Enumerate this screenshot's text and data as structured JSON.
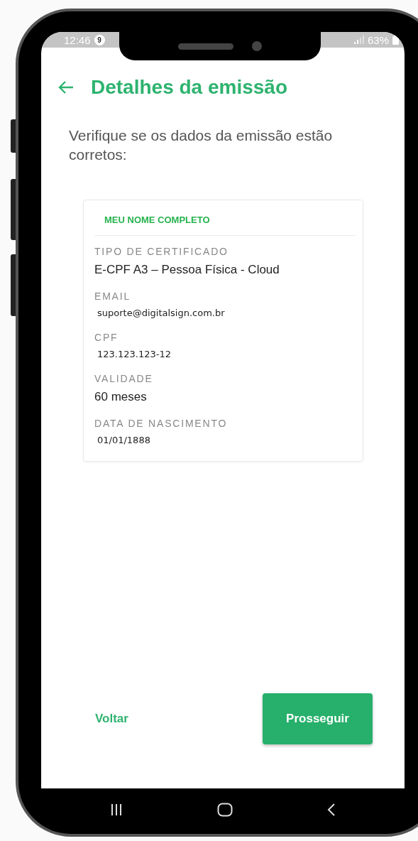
{
  "status_bar": {
    "time": "12:46",
    "notification_count": "9",
    "battery": "63%"
  },
  "header": {
    "title": "Detalhes da emissão"
  },
  "intro": "Verifique se os dados da emissão estão corretos:",
  "card": {
    "name": "MEU NOME COMPLETO",
    "fields": [
      {
        "label": "TIPO DE CERTIFICADO",
        "value": "E-CPF A3 – Pessoa Física - Cloud",
        "kind": "sans"
      },
      {
        "label": "EMAIL",
        "value": "suporte@digitalsign.com.br",
        "kind": "alt"
      },
      {
        "label": "CPF",
        "value": "123.123.123-12",
        "kind": "alt"
      },
      {
        "label": "VALIDADE",
        "value": "60 meses",
        "kind": "sans"
      },
      {
        "label": "DATA DE NASCIMENTO",
        "value": "01/01/1888",
        "kind": "alt"
      }
    ]
  },
  "actions": {
    "back": "Voltar",
    "proceed": "Prosseguir"
  }
}
